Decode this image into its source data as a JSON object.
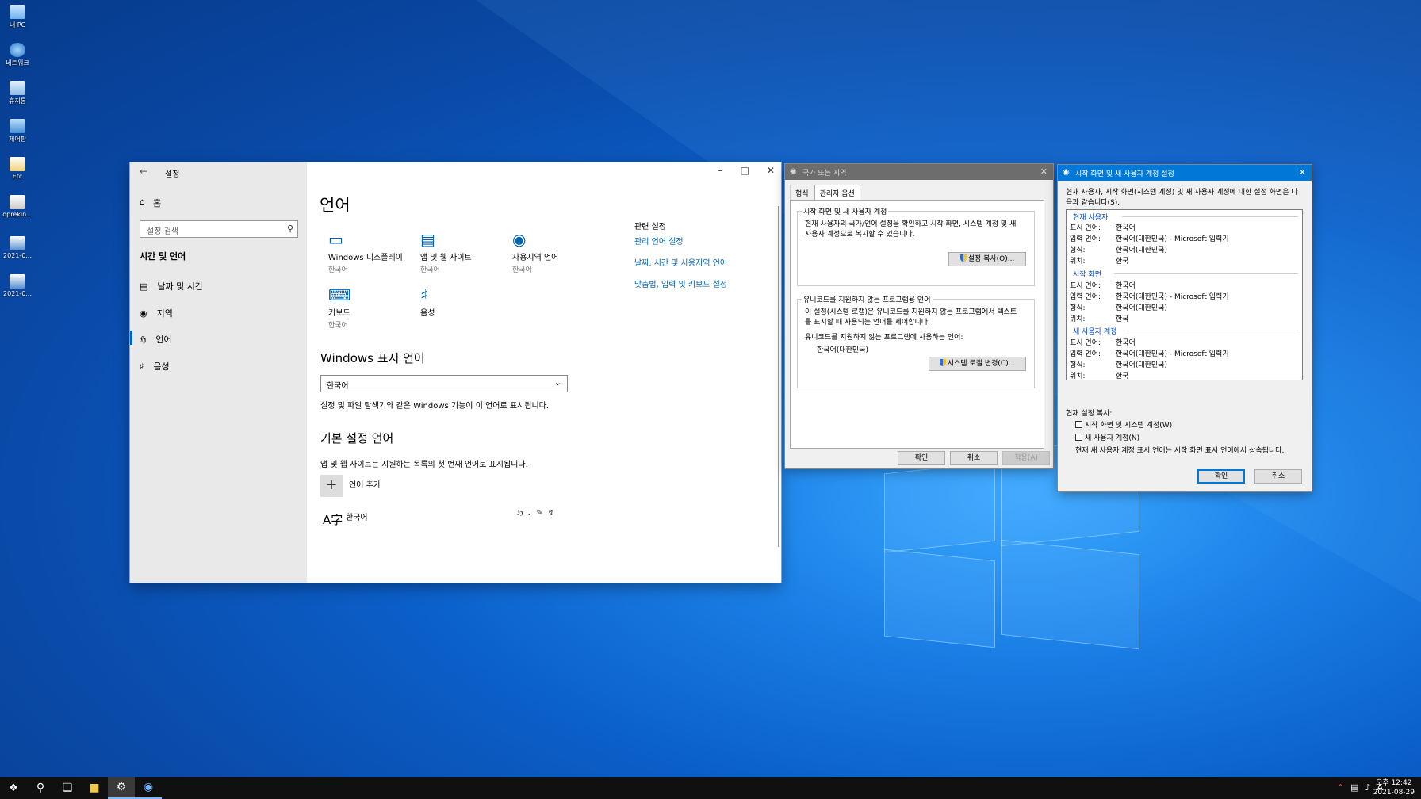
{
  "desktop_icons": [
    {
      "name": "this-pc",
      "label": "내 PC"
    },
    {
      "name": "network",
      "label": "네트워크"
    },
    {
      "name": "recycle-bin",
      "label": "휴지통"
    },
    {
      "name": "control-panel",
      "label": "제어판"
    },
    {
      "name": "etc",
      "label": "Etc"
    },
    {
      "name": "oprekin",
      "label": "oprekin..."
    },
    {
      "name": "file-2021-a",
      "label": "2021-0..."
    },
    {
      "name": "file-2021-b",
      "label": "2021-0..."
    }
  ],
  "settings": {
    "title": "설정",
    "home": "홈",
    "search_placeholder": "설정 검색",
    "section": "시간 및 언어",
    "nav": [
      "날짜 및 시간",
      "지역",
      "언어",
      "음성"
    ],
    "page_title": "언어",
    "tiles": [
      {
        "label": "Windows 디스플레이",
        "sub": "한국어"
      },
      {
        "label": "앱 및 웹 사이트",
        "sub": "한국어"
      },
      {
        "label": "사용지역 언어",
        "sub": "한국어"
      },
      {
        "label": "키보드",
        "sub": "한국어"
      },
      {
        "label": "음성",
        "sub": ""
      }
    ],
    "display_lang_heading": "Windows 표시 언어",
    "display_lang_value": "한국어",
    "display_lang_desc": "설정 및 파일 탐색기와 같은 Windows 기능이 이 언어로 표시됩니다.",
    "pref_lang_heading": "기본 설정 언어",
    "pref_lang_desc": "앱 및 웹 사이트는 지원하는 목록의 첫 번째 언어로 표시됩니다.",
    "add_lang": "언어 추가",
    "installed_lang": "한국어",
    "related_title": "관련 설정",
    "related_links": [
      "관리 언어 설정",
      "날짜, 시간 및 사용지역 언어",
      "맞춤법, 입력 및 키보드 설정"
    ]
  },
  "region": {
    "title": "국가 또는 지역",
    "tabs": [
      "형식",
      "관리자 옵션"
    ],
    "group1_title": "시작 화면 및 새 사용자 계정",
    "group1_text": [
      "현재 사용자의 국가/언어 설정을 확인하고 시작 화면, 시스템 계정 및 새",
      "사용자 계정으로 복사할 수 있습니다."
    ],
    "copy_btn": "설정 복사(O)...",
    "group2_title": "유니코드를 지원하지 않는 프로그램용 언어",
    "group2_text": [
      "이 설정(시스템 로캘)은 유니코드를 지원하지 않는 프로그램에서 텍스트",
      "를 표시할 때 사용되는 언어를 제어합니다."
    ],
    "current_label": "유니코드를 지원하지 않는 프로그램에 사용하는 언어:",
    "current_value": "한국어(대한민국)",
    "change_btn": "시스템 로캘 변경(C)...",
    "ok": "확인",
    "cancel": "취소",
    "apply": "적용(A)"
  },
  "welcome": {
    "title": "시작 화면 및 새 사용자 계정 설정",
    "desc": [
      "현재 사용자, 시작 화면(시스템 계정) 및 새 사용자 계정에 대한 설정 화면은 다",
      "음과 같습니다(S)."
    ],
    "sections": [
      {
        "heading": "현재 사용자",
        "rows": [
          [
            "표시 언어:",
            "한국어"
          ],
          [
            "입력 언어:",
            "한국어(대한민국) - Microsoft 입력기"
          ],
          [
            "형식:",
            "한국어(대한민국)"
          ],
          [
            "위치:",
            "한국"
          ]
        ]
      },
      {
        "heading": "시작 화면",
        "rows": [
          [
            "표시 언어:",
            "한국어"
          ],
          [
            "입력 언어:",
            "한국어(대한민국) - Microsoft 입력기"
          ],
          [
            "형식:",
            "한국어(대한민국)"
          ],
          [
            "위치:",
            "한국"
          ]
        ]
      },
      {
        "heading": "새 사용자 계정",
        "rows": [
          [
            "표시 언어:",
            "한국어"
          ],
          [
            "입력 언어:",
            "한국어(대한민국) - Microsoft 입력기"
          ],
          [
            "형식:",
            "한국어(대한민국)"
          ],
          [
            "위치:",
            "한국"
          ]
        ]
      }
    ],
    "copy_label": "현재 설정 복사:",
    "chk1": "시작 화면 및 시스템 계정(W)",
    "chk2": "새 사용자 계정(N)",
    "note": "현재 새 사용자 계정 표시 언어는 시작 화면 표시 언어에서 상속됩니다.",
    "ok": "확인",
    "cancel": "취소"
  },
  "taskbar": {
    "ime": "A",
    "time": "오후 12:42",
    "date": "2021-08-29"
  }
}
